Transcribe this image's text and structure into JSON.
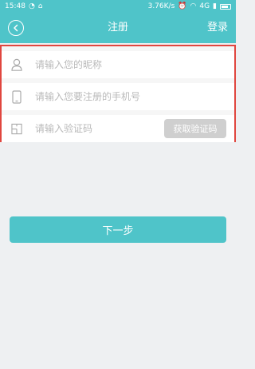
{
  "status_bar": {
    "time": "15:48",
    "speed": "3.76K/s",
    "network": "4G"
  },
  "header": {
    "title": "注册",
    "login_label": "登录"
  },
  "form": {
    "nickname_placeholder": "请输入您的昵称",
    "phone_placeholder": "请输入您要注册的手机号",
    "code_placeholder": "请输入验证码",
    "get_code_label": "获取验证码"
  },
  "actions": {
    "next_label": "下一步"
  },
  "colors": {
    "brand": "#4fc4c9",
    "button_disabled": "#cfcfcf",
    "highlight_border": "#e0463f"
  },
  "icons": [
    "back-icon",
    "user-icon",
    "phone-icon",
    "verification-icon"
  ]
}
